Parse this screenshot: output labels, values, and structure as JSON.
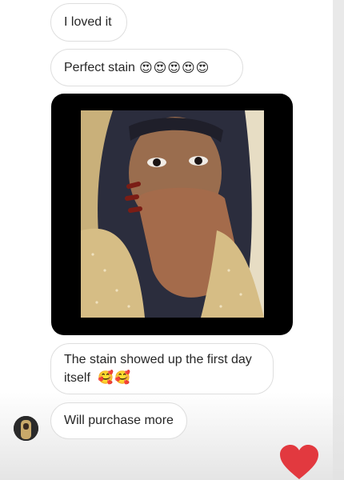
{
  "messages": [
    {
      "text": "I loved it",
      "emoji": ""
    },
    {
      "text": "Perfect stain",
      "emoji": "😍😍😍😍😍"
    },
    {
      "text": "The stain showed up the first day itself",
      "emoji": "🥰🥰"
    },
    {
      "text": "Will purchase more",
      "emoji": ""
    }
  ],
  "photo": {
    "icon": "shared-photo"
  },
  "avatar": {
    "icon": "user-avatar"
  },
  "colors": {
    "bubble_border": "#dedede",
    "heart": "#e2393f",
    "photo_frame": "#000000"
  },
  "actions": {
    "like_icon": "heart-icon"
  }
}
